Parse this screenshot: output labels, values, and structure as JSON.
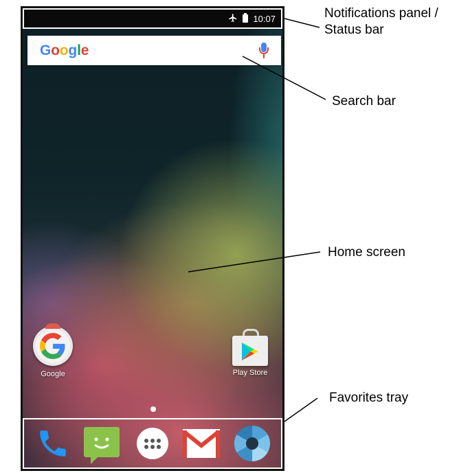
{
  "status_bar": {
    "time": "10:07",
    "icons": [
      "airplane-icon",
      "battery-icon"
    ]
  },
  "search_bar": {
    "logo_text": "Google",
    "icon": "mic-icon"
  },
  "home_apps": [
    {
      "label": "Google",
      "icon": "google-app-icon"
    },
    {
      "label": "Play Store",
      "icon": "play-store-icon"
    }
  ],
  "page_indicator": {
    "current": 1,
    "total": 1
  },
  "favorites_tray": [
    "phone-icon",
    "messenger-icon",
    "apps-icon",
    "gmail-icon",
    "camera-icon"
  ],
  "callouts": {
    "status_line1": "Notifications panel /",
    "status_line2": "Status bar",
    "search": "Search bar",
    "home": "Home screen",
    "tray": "Favorites tray"
  },
  "colors": {
    "google_blue": "#4285f4",
    "google_red": "#db4437",
    "google_yellow": "#f4b400",
    "google_green": "#0f9d58",
    "messenger_green": "#8bc34a",
    "phone_blue": "#2196f3"
  }
}
